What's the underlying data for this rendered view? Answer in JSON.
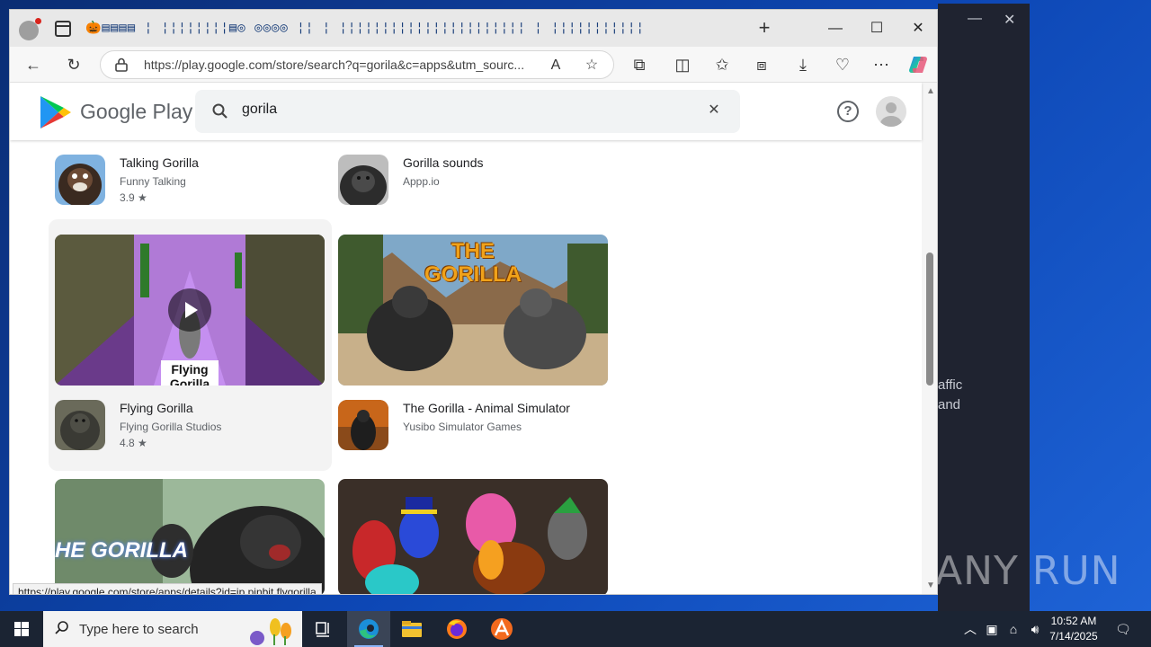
{
  "browser": {
    "tab_strip_text": "🎃▤▤▤▤ ¦ ¦¦¦¦¦¦¦¦▤◎ ◎◎◎◎ ¦¦ ¦ ¦¦¦¦¦¦¦¦¦¦¦¦¦¦¦¦¦¦¦¦¦¦ ¦ ¦¦¦¦¦¦¦¦¦¦¦",
    "address": "https://play.google.com/store/search?q=gorila&c=apps&utm_sourc...",
    "status_link": "https://play.google.com/store/apps/details?id=jp.pinbit.flygorilla"
  },
  "play": {
    "brand": "Google Play",
    "search_value": "gorila",
    "help_label": "?"
  },
  "apps": [
    {
      "name": "Talking Gorilla",
      "developer": "Funny Talking",
      "rating": "3.9 ★"
    },
    {
      "name": "Gorilla sounds",
      "developer": "Appp.io",
      "rating": ""
    },
    {
      "name": "Flying Gorilla",
      "developer": "Flying Gorilla Studios",
      "rating": "4.8 ★"
    },
    {
      "name": "The Gorilla - Animal Simulator",
      "developer": "Yusibo Simulator Games",
      "rating": ""
    }
  ],
  "thumbnails": {
    "flying_caption": "Flying Gorilla",
    "gorilla_title": "THE GORILLA",
    "third_title": "HE GORILLA"
  },
  "background_window": {
    "text_line1": "affic",
    "text_line2": "and"
  },
  "watermark": "ANY RUN",
  "taskbar": {
    "search_placeholder": "Type here to search",
    "time": "10:52 AM",
    "date": "7/14/2025"
  }
}
